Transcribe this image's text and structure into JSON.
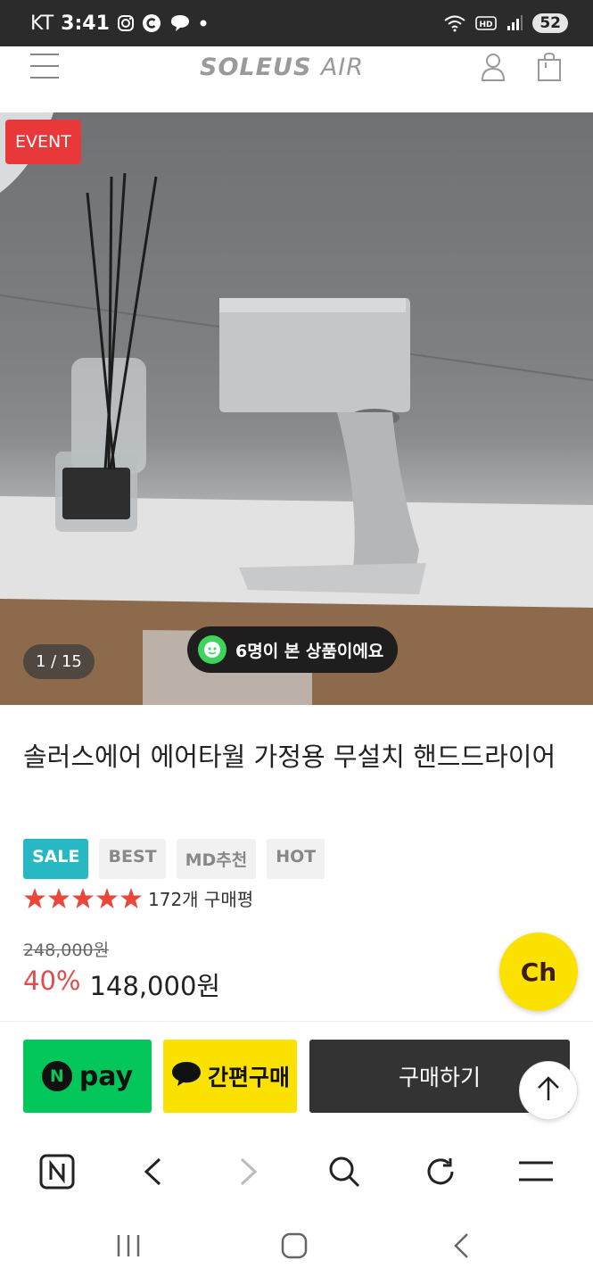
{
  "status_bar": {
    "carrier": "KT",
    "time": "3:41",
    "battery": "52"
  },
  "header": {
    "logo_main": "SOLEUS",
    "logo_sub": "AIR"
  },
  "hero": {
    "event_badge": "EVENT",
    "image_counter": "1 / 15",
    "viewers_text": "6명이 본 상품이에요"
  },
  "product": {
    "title": "솔러스에어 에어타월 가정용 무설치 핸드드라이어",
    "tags": [
      "SALE",
      "BEST",
      "MD추천",
      "HOT"
    ],
    "rating_stars": 5,
    "review_count": "172개 구매평",
    "original_price": "248,000원",
    "discount": "40%",
    "price": "148,000원"
  },
  "kakao_channel": {
    "label": "Ch"
  },
  "buy_bar": {
    "npay_label": "pay",
    "npay_n": "N",
    "kakao_label": "간편구매",
    "buy_label": "구매하기"
  },
  "colors": {
    "sale_tag": "#27b8c4",
    "discount": "#e24b4b",
    "npay": "#03c75a",
    "kakao": "#fae100",
    "event": "#e8383a",
    "star": "#e8473a"
  }
}
